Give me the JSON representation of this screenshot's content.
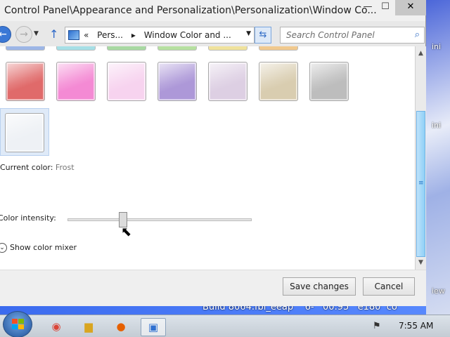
{
  "window": {
    "title": "Control Panel\\Appearance and Personalization\\Personalization\\Window Co...",
    "minimize_symbol": "—",
    "maximize_symbol": "☐",
    "close_symbol": "✕"
  },
  "address_bar": {
    "prefix": "«",
    "crumbs": [
      "Pers...",
      "▸",
      "Window Color and ..."
    ],
    "dropdown_symbol": "▼",
    "refresh_symbol": "⇆"
  },
  "search": {
    "placeholder": "Search Control Panel",
    "icon": "magnifier-icon"
  },
  "colors": {
    "swatches_row1": [
      "#9db6e6",
      "#a6dfe6",
      "#a8d9a2",
      "#b6e0a0",
      "#f0e29c",
      "#f1c98e"
    ],
    "swatches_row2": [
      {
        "name": "red",
        "color": "#e06a6a"
      },
      {
        "name": "pink",
        "color": "#f48ad4"
      },
      {
        "name": "light-pink",
        "color": "#f7d3ef"
      },
      {
        "name": "violet",
        "color": "#ad98d8"
      },
      {
        "name": "lavender",
        "color": "#ddcfe3"
      },
      {
        "name": "taupe",
        "color": "#d9cdb0"
      },
      {
        "name": "gray",
        "color": "#bdbdbd"
      }
    ],
    "selected": {
      "name": "frost",
      "color": "#eef1f5"
    }
  },
  "current_color": {
    "label": "Current color:",
    "value": "Frost"
  },
  "intensity": {
    "label": "Color intensity:",
    "level": 0.3
  },
  "mixer": {
    "label": "Show color mixer",
    "expanded": false
  },
  "buttons": {
    "save": "Save changes",
    "cancel": "Cancel"
  },
  "desktop": {
    "labels": [
      "ini",
      "ini",
      "iew"
    ],
    "build_text": "Build 8064.fbl_eeap    6-   00.95   e180  co"
  },
  "taskbar": {
    "apps": [
      "chrome-icon",
      "explorer-folder-icon",
      "firefox-icon",
      "control-panel-icon"
    ],
    "clock": "7:55 AM"
  }
}
